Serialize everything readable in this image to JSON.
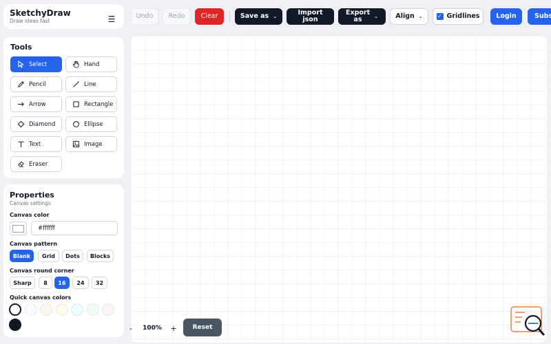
{
  "brand": {
    "title": "SketchyDraw",
    "subtitle": "Draw ideas fast",
    "menu_icon": "hamburger-icon"
  },
  "toolbar": {
    "undo": "Undo",
    "redo": "Redo",
    "clear": "Clear",
    "save_as": "Save as",
    "import_line1": "Import",
    "import_line2": "json",
    "export_line1": "Export",
    "export_line2": "as",
    "align": "Align",
    "gridlines": "Gridlines",
    "gridlines_checked": true,
    "login": "Login",
    "subscribe": "Subs"
  },
  "tools": {
    "heading": "Tools",
    "items": [
      {
        "label": "Select",
        "icon": "cursor-icon",
        "active": true
      },
      {
        "label": "Hand",
        "icon": "hand-icon"
      },
      {
        "label": "Pencil",
        "icon": "pencil-icon"
      },
      {
        "label": "Line",
        "icon": "line-icon"
      },
      {
        "label": "Arrow",
        "icon": "arrow-right-icon"
      },
      {
        "label": "Rectangle",
        "icon": "rectangle-icon"
      },
      {
        "label": "Diamond",
        "icon": "diamond-icon"
      },
      {
        "label": "Ellipse",
        "icon": "ellipse-icon"
      },
      {
        "label": "Text",
        "icon": "text-icon"
      },
      {
        "label": "Image",
        "icon": "image-icon"
      },
      {
        "label": "Eraser",
        "icon": "eraser-icon"
      }
    ]
  },
  "properties": {
    "title": "Properties",
    "subtitle": "Canvas settings",
    "canvas_color_label": "Canvas color",
    "canvas_color_value": "#ffffff",
    "pattern_label": "Canvas pattern",
    "patterns": [
      "Blank",
      "Grid",
      "Dots",
      "Blocks"
    ],
    "pattern_selected": "Blank",
    "corner_label": "Canvas round corner",
    "corners": [
      "Sharp",
      "8",
      "16",
      "24",
      "32"
    ],
    "corner_selected": "16",
    "quick_colors_label": "Quick canvas colors",
    "quick_colors": [
      "#ffffff",
      "#f8fafc",
      "#fef7ee",
      "#fefce8",
      "#ecfeff",
      "#f0fdf4",
      "#fdf2f8",
      "#111827"
    ]
  },
  "zoom": {
    "minus": "-",
    "value": "100%",
    "plus": "+",
    "reset": "Reset"
  },
  "colors": {
    "accent": "#2563eb",
    "danger": "#dc2626",
    "dark": "#111827",
    "reset": "#4b5563"
  }
}
